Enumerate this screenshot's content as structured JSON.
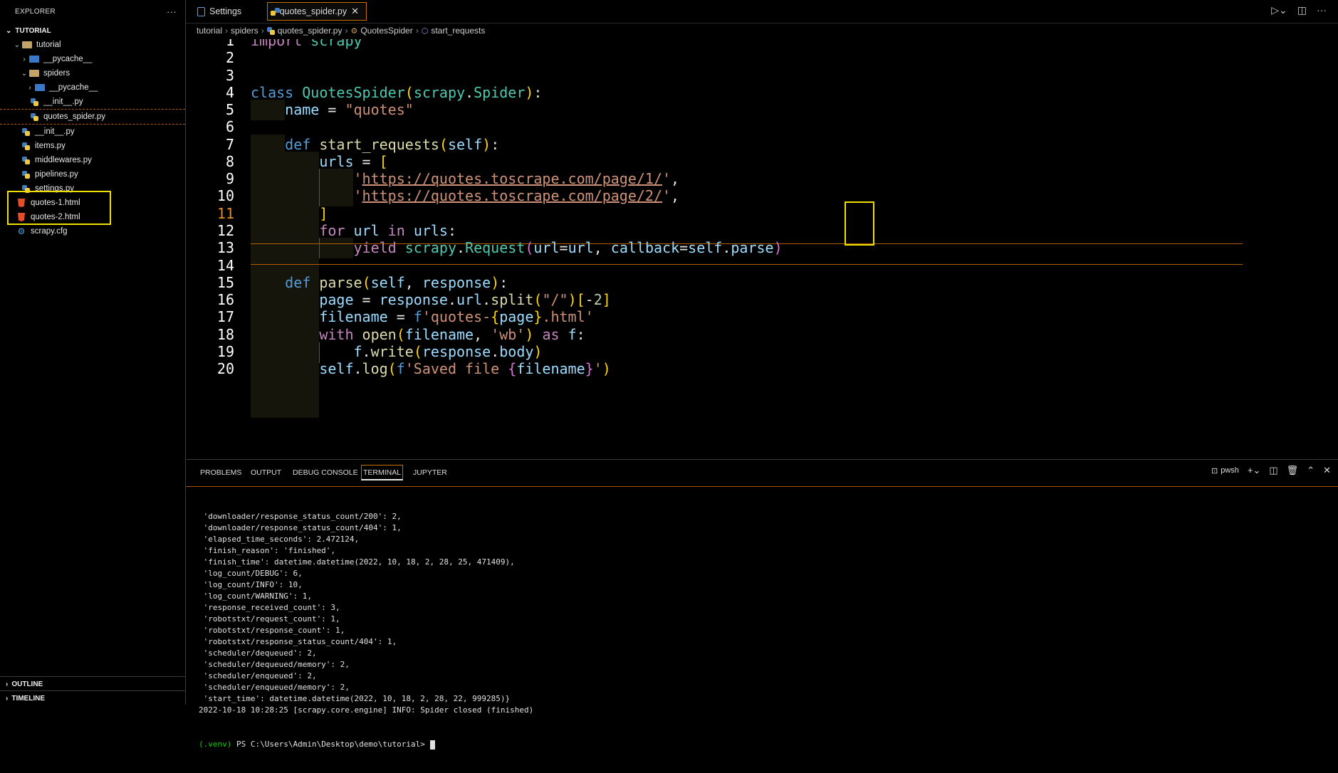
{
  "explorer": {
    "title": "EXPLORER",
    "more": "···",
    "workspace": "TUTORIAL",
    "tree": [
      {
        "label": "tutorial",
        "chevron": "⌄",
        "icon": "folder"
      },
      {
        "label": "__pycache__",
        "chevron": "›",
        "icon": "folder-blue"
      },
      {
        "label": "spiders",
        "chevron": "⌄",
        "icon": "folder"
      },
      {
        "label": "__pycache__",
        "chevron": "›",
        "icon": "folder-blue"
      },
      {
        "label": "__init__.py",
        "chevron": "",
        "icon": "python"
      },
      {
        "label": "quotes_spider.py",
        "chevron": "",
        "icon": "python"
      },
      {
        "label": "__init__.py",
        "chevron": "",
        "icon": "python"
      },
      {
        "label": "items.py",
        "chevron": "",
        "icon": "python"
      },
      {
        "label": "middlewares.py",
        "chevron": "",
        "icon": "python"
      },
      {
        "label": "pipelines.py",
        "chevron": "",
        "icon": "python"
      },
      {
        "label": "settings.py",
        "chevron": "",
        "icon": "python"
      },
      {
        "label": "quotes-1.html",
        "chevron": "",
        "icon": "html"
      },
      {
        "label": "quotes-2.html",
        "chevron": "",
        "icon": "html"
      },
      {
        "label": "scrapy.cfg",
        "chevron": "",
        "icon": "gear"
      }
    ],
    "outline": "OUTLINE",
    "timeline": "TIMELINE"
  },
  "tabs": [
    {
      "label": "Settings",
      "icon": "settings-file-icon"
    },
    {
      "label": "quotes_spider.py",
      "icon": "python-icon",
      "close": "✕"
    }
  ],
  "breadcrumb": [
    "tutorial",
    "spiders",
    "quotes_spider.py",
    "QuotesSpider",
    "start_requests"
  ],
  "editor": {
    "line_numbers": [
      "1",
      "2",
      "3",
      "4",
      "5",
      "6",
      "7",
      "8",
      "9",
      "10",
      "11",
      "12",
      "13",
      "14",
      "15",
      "16",
      "17",
      "18",
      "19",
      "20"
    ],
    "active_line": "11"
  },
  "panel": {
    "tabs": [
      "PROBLEMS",
      "OUTPUT",
      "DEBUG CONSOLE",
      "TERMINAL",
      "JUPYTER"
    ],
    "active_tab": "TERMINAL",
    "shell": "pwsh",
    "terminal_lines": [
      " 'downloader/response_status_count/200': 2,",
      " 'downloader/response_status_count/404': 1,",
      " 'elapsed_time_seconds': 2.472124,",
      " 'finish_reason': 'finished',",
      " 'finish_time': datetime.datetime(2022, 10, 18, 2, 28, 25, 471409),",
      " 'log_count/DEBUG': 6,",
      " 'log_count/INFO': 10,",
      " 'log_count/WARNING': 1,",
      " 'response_received_count': 3,",
      " 'robotstxt/request_count': 1,",
      " 'robotstxt/response_count': 1,",
      " 'robotstxt/response_status_count/404': 1,",
      " 'scheduler/dequeued': 2,",
      " 'scheduler/dequeued/memory': 2,",
      " 'scheduler/enqueued': 2,",
      " 'scheduler/enqueued/memory': 2,",
      " 'start_time': datetime.datetime(2022, 10, 18, 2, 28, 22, 999285)}",
      "2022-10-18 10:28:25 [scrapy.core.engine] INFO: Spider closed (finished)"
    ],
    "prompt_venv": "(.venv)",
    "prompt_path": " PS C:\\Users\\Admin\\Desktop\\demo\\tutorial> "
  }
}
